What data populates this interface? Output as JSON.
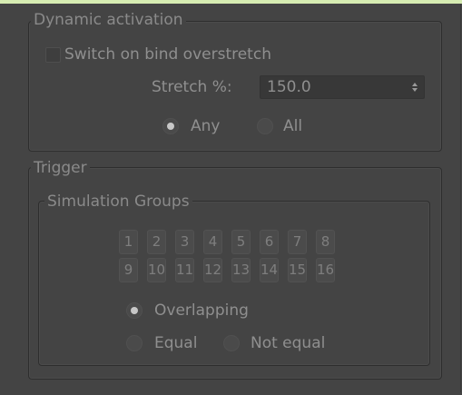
{
  "dynamic_activation": {
    "title": "Dynamic activation",
    "switch_label": "Switch on bind overstretch",
    "switch_checked": false,
    "stretch_label": "Stretch %:",
    "stretch_value": "150.0",
    "mode_any": "Any",
    "mode_all": "All",
    "selected_mode": "Any"
  },
  "trigger": {
    "title": "Trigger",
    "simulation_groups": {
      "title": "Simulation Groups",
      "row1": [
        "1",
        "2",
        "3",
        "4",
        "5",
        "6",
        "7",
        "8"
      ],
      "row2": [
        "9",
        "10",
        "11",
        "12",
        "13",
        "14",
        "15",
        "16"
      ]
    },
    "overlapping": "Overlapping",
    "equal": "Equal",
    "not_equal": "Not equal",
    "selected": "Overlapping"
  },
  "colors": {
    "top_strip": "#d6ecb2",
    "panel_bg": "#444444"
  }
}
